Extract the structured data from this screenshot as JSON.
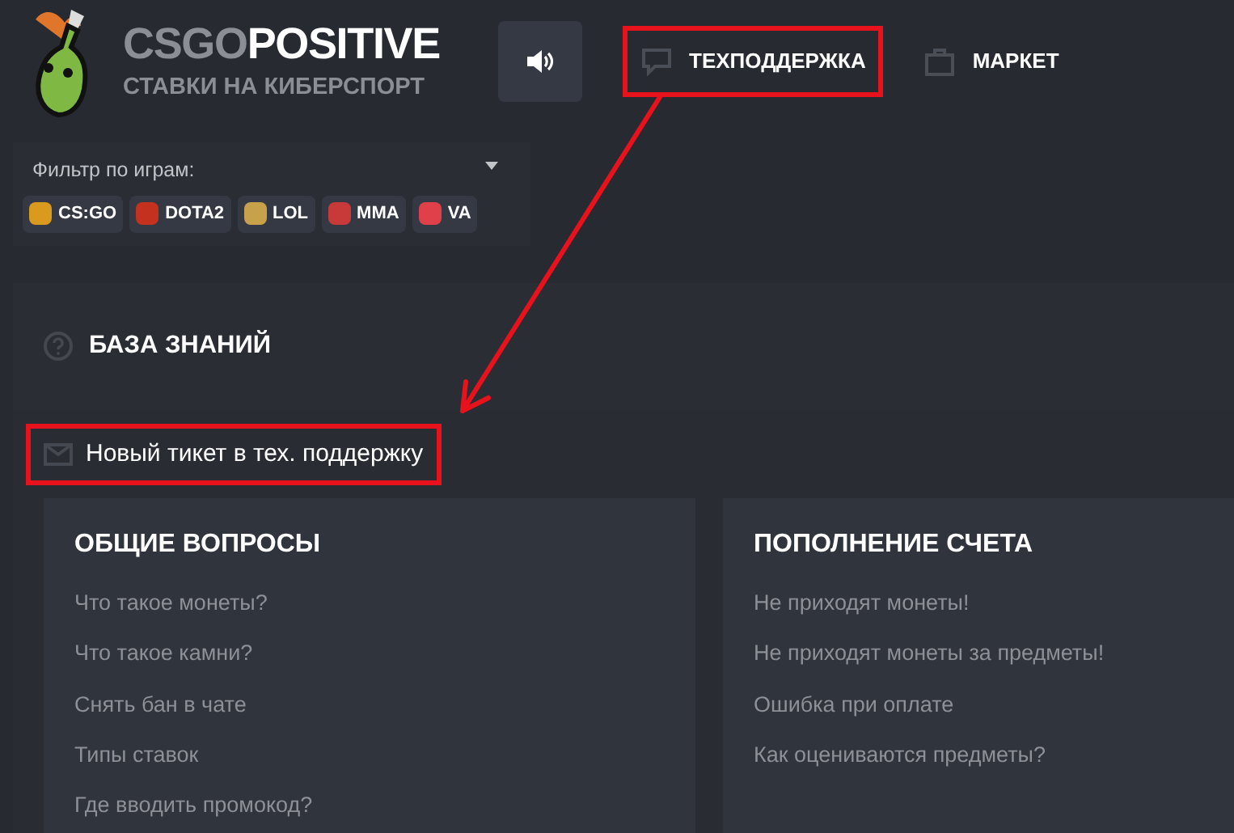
{
  "logo": {
    "brand_light": "CSGO",
    "brand_bold": "POSITIVE",
    "tagline": "СТАВКИ НА КИБЕРСПОРТ"
  },
  "nav": [
    {
      "label": "ТЕХПОДДЕРЖКА",
      "kind": "chat",
      "highlighted": true
    },
    {
      "label": "МАРКЕТ",
      "kind": "bag",
      "highlighted": false
    }
  ],
  "filter": {
    "label": "Фильтр по играм:",
    "games": [
      {
        "label": "CS:GO",
        "color": "#d99a1e"
      },
      {
        "label": "DOTA2",
        "color": "#c4321f"
      },
      {
        "label": "LOL",
        "color": "#c8a24a"
      },
      {
        "label": "MMA",
        "color": "#c83a3a"
      },
      {
        "label": "VA",
        "color": "#e0404a"
      }
    ]
  },
  "knowledge_base": {
    "title": "БАЗА ЗНАНИЙ",
    "new_ticket": {
      "label": "Новый тикет в тех. поддержку",
      "highlighted": true
    },
    "sections": [
      {
        "title": "ОБЩИЕ ВОПРОСЫ",
        "links": [
          "Что такое монеты?",
          "Что такое камни?",
          "Снять бан в чате",
          "Типы ставок",
          "Где вводить промокод?"
        ]
      },
      {
        "title": "ПОПОЛНЕНИЕ СЧЕТА",
        "links": [
          "Не приходят монеты!",
          "Не приходят монеты за предметы!",
          "Ошибка при оплате",
          "Как оцениваются предметы?"
        ]
      }
    ]
  }
}
